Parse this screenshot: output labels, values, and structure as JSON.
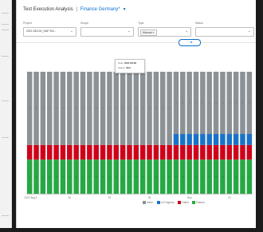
{
  "header": {
    "title": "Test Execution Analysis",
    "separator": "|",
    "variant": "Finance Germany",
    "variant_marker": "*",
    "variant_chevron": "chevron-down-icon"
  },
  "filters": [
    {
      "label": "Project",
      "value": "2021.08.101_SAP S/4...",
      "dropdown_icon": "chevron-down-icon"
    },
    {
      "label": "Scope",
      "value": "",
      "dropdown_icon": "chevron-down-icon"
    },
    {
      "label": "Type",
      "token": "Manual ×",
      "dropdown_icon": "chevron-down-icon"
    },
    {
      "label": "Status",
      "value": "",
      "dropdown_icon": "chevron-down-icon"
    }
  ],
  "collapse_toggle": "⌃ ⇌",
  "tooltip": {
    "date_label": "Date:",
    "date_value": "2021.08.09",
    "status_label": "Status:",
    "status_value": "Skit"
  },
  "chart_data": {
    "type": "bar",
    "stacked": true,
    "categories": [
      "2021 Aug",
      "",
      "",
      "",
      "",
      "",
      "",
      "",
      "",
      "",
      "",
      "",
      "",
      "",
      "",
      "",
      "",
      "",
      "",
      "",
      "",
      "",
      "",
      "",
      "",
      "",
      "",
      "",
      "",
      "",
      "",
      "",
      "",
      ""
    ],
    "x_tick_labels": [
      "2021 Aug",
      "9",
      "",
      "",
      "",
      "",
      "16",
      "",
      "",
      "",
      "",
      "",
      "23",
      "",
      "",
      "",
      "",
      "",
      "30",
      "",
      "",
      "",
      "",
      "",
      "Sep",
      "",
      "",
      "",
      "",
      "",
      "13",
      "",
      "",
      ""
    ],
    "series": [
      {
        "name": "Passed",
        "color": "#27a844",
        "values": [
          28,
          28,
          28,
          28,
          28,
          28,
          28,
          28,
          28,
          28,
          28,
          28,
          28,
          28,
          28,
          28,
          28,
          28,
          28,
          28,
          28,
          28,
          28,
          28,
          28,
          28,
          28,
          28,
          28,
          28,
          28,
          28,
          28,
          28
        ]
      },
      {
        "name": "Failed",
        "color": "#d0021b",
        "values": [
          12,
          12,
          12,
          12,
          12,
          12,
          12,
          12,
          12,
          12,
          12,
          12,
          12,
          12,
          12,
          12,
          12,
          12,
          12,
          12,
          12,
          12,
          12,
          12,
          12,
          12,
          12,
          12,
          12,
          12,
          12,
          12,
          12,
          12
        ]
      },
      {
        "name": "In Progress",
        "color": "#1a73c8",
        "values": [
          0,
          0,
          0,
          0,
          0,
          0,
          0,
          0,
          0,
          0,
          0,
          0,
          0,
          0,
          0,
          0,
          0,
          0,
          0,
          0,
          0,
          0,
          9,
          9,
          9,
          9,
          9,
          9,
          9,
          9,
          9,
          9,
          9,
          9
        ]
      },
      {
        "name": "Initial",
        "color": "#8c9196",
        "values": [
          60,
          60,
          60,
          60,
          60,
          60,
          60,
          60,
          60,
          60,
          60,
          60,
          60,
          60,
          60,
          60,
          60,
          60,
          60,
          60,
          60,
          60,
          51,
          51,
          51,
          51,
          51,
          51,
          51,
          51,
          51,
          51,
          51,
          51
        ]
      }
    ],
    "ylim": [
      0,
      100
    ],
    "grid": false,
    "legend": "bottom-right",
    "xlabel": "",
    "ylabel": ""
  }
}
